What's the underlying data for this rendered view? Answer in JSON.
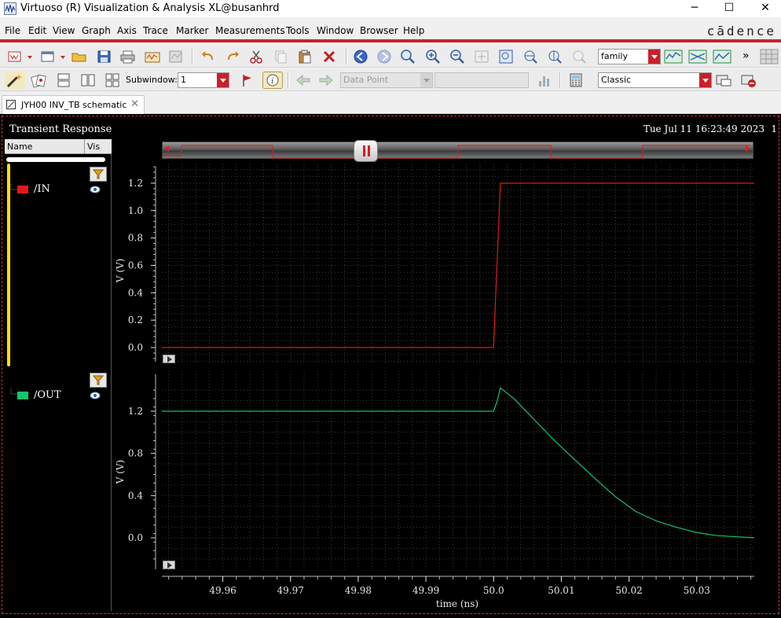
{
  "window": {
    "title": "Virtuoso (R) Visualization & Analysis XL@busanhrd",
    "controls": [
      "─",
      "☐",
      "✕"
    ]
  },
  "menu": [
    "File",
    "Edit",
    "View",
    "Graph",
    "Axis",
    "Trace",
    "Marker",
    "Measurements",
    "Tools",
    "Window",
    "Browser",
    "Help"
  ],
  "brand": "cādence",
  "toolbar": {
    "family_select": "family",
    "subwindow_label": "Subwindow:",
    "subwindow_value": "1",
    "data_point_select": "Data Point",
    "data_point_value": "",
    "style_select": "Classic",
    "overflow": "»"
  },
  "tab": {
    "label": "JYH00 INV_TB schematic",
    "close": "✕"
  },
  "graph": {
    "name": "Transient Response",
    "date": "Tue Jul 11 16:23:49 2023",
    "page": "1"
  },
  "legend": {
    "col_name": "Name",
    "col_vis": "Vis",
    "signals": [
      {
        "name": "/IN",
        "color": "#e01a1a"
      },
      {
        "name": "/OUT",
        "color": "#15c46a"
      }
    ]
  },
  "chart_data": [
    {
      "type": "line",
      "title": "",
      "xlabel": "time (ns)",
      "ylabel": "V (V)",
      "xlim": [
        49.951,
        50.0385
      ],
      "ylim": [
        -0.09,
        1.3
      ],
      "yticks": [
        0.0,
        0.2,
        0.4,
        0.6,
        0.8,
        1.0,
        1.2
      ],
      "ytick_labels": [
        "0.0",
        "0.2",
        "0.4",
        "0.6",
        "0.8",
        "1.0",
        "1.2"
      ],
      "grid": true,
      "series": [
        {
          "name": "/IN",
          "color": "#e01a1a",
          "x": [
            49.951,
            50.0,
            50.0005,
            50.001,
            50.0385
          ],
          "y": [
            0.0,
            0.0,
            0.6,
            1.2,
            1.2
          ]
        }
      ]
    },
    {
      "type": "line",
      "title": "",
      "xlabel": "time (ns)",
      "ylabel": "V (V)",
      "xlim": [
        49.951,
        50.0385
      ],
      "ylim": [
        -0.27,
        1.47
      ],
      "yticks": [
        0.0,
        0.4,
        0.8,
        1.2
      ],
      "ytick_labels": [
        "0.0",
        "0.4",
        "0.8",
        "1.2"
      ],
      "xticks": [
        49.96,
        49.97,
        49.98,
        49.99,
        50.0,
        50.01,
        50.02,
        50.03
      ],
      "xtick_labels": [
        "49.96",
        "49.97",
        "49.98",
        "49.99",
        "50.0",
        "50.01",
        "50.02",
        "50.03"
      ],
      "grid": true,
      "series": [
        {
          "name": "/OUT",
          "color": "#15c46a",
          "x": [
            49.951,
            50.0,
            50.0005,
            50.001,
            50.003,
            50.006,
            50.009,
            50.012,
            50.015,
            50.018,
            50.021,
            50.024,
            50.027,
            50.03,
            50.033,
            50.036,
            50.0385
          ],
          "y": [
            1.2,
            1.2,
            1.29,
            1.42,
            1.32,
            1.12,
            0.92,
            0.74,
            0.56,
            0.39,
            0.25,
            0.16,
            0.1,
            0.05,
            0.02,
            0.01,
            0.0
          ]
        }
      ]
    }
  ],
  "slider": {
    "waveform_color": "#e01a1a"
  }
}
